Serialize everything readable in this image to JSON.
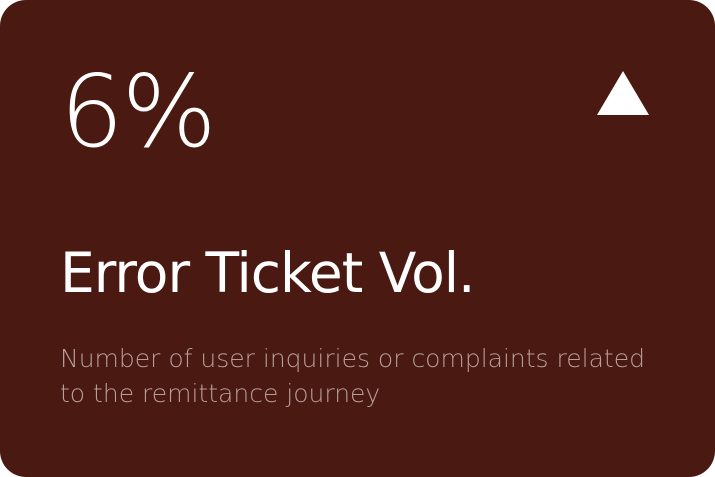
{
  "card": {
    "value": "6%",
    "trend": "up",
    "trend_icon": "triangle-up-icon",
    "title": "Error Ticket Vol.",
    "description": "Number of user inquiries or complaints related to the remittance journey"
  },
  "colors": {
    "card_background": "#4a1a12",
    "primary_text": "#ffffff",
    "secondary_text": "#b89e99"
  }
}
